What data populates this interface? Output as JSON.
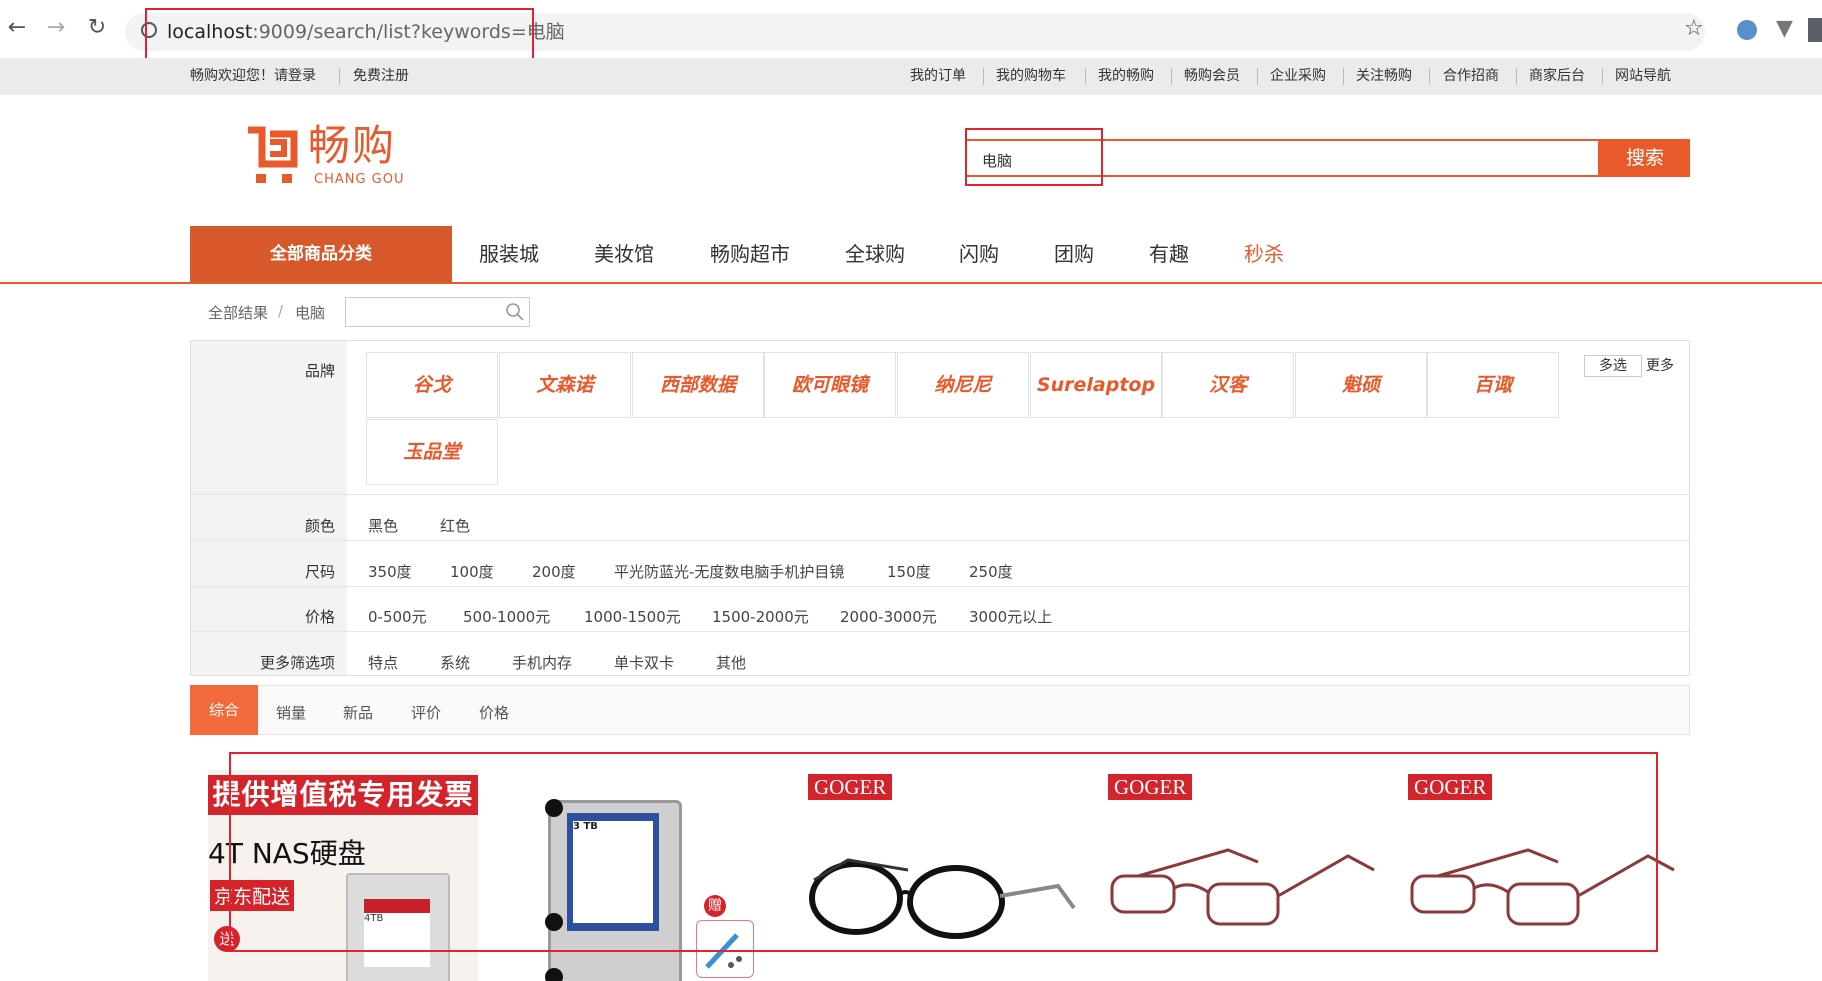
{
  "browser": {
    "url_host": "localhost",
    "url_rest": ":9009/search/list?keywords=电脑"
  },
  "topbar": {
    "welcome": "畅购欢迎您！",
    "login": "请登录",
    "register": "免费注册",
    "links": [
      "我的订单",
      "我的购物车",
      "我的畅购",
      "畅购会员",
      "企业采购",
      "关注畅购",
      "合作招商",
      "商家后台",
      "网站导航"
    ]
  },
  "logo": {
    "cn": "畅购",
    "en": "CHANG GOU"
  },
  "search": {
    "value": "电脑",
    "button": "搜索"
  },
  "nav": {
    "all_categories": "全部商品分类",
    "items": [
      "服装城",
      "美妆馆",
      "畅购超市",
      "全球购",
      "闪购",
      "团购",
      "有趣",
      "秒杀"
    ]
  },
  "breadcrumb": {
    "root": "全部结果",
    "sep": "/",
    "current": "电脑"
  },
  "filters": {
    "brand_label": "品牌",
    "brands": [
      "谷戈",
      "文森诺",
      "西部数据",
      "欧可眼镜",
      "纳尼尼",
      "Surelaptop",
      "汉客",
      "魁硕",
      "百诹",
      "玉品堂"
    ],
    "multi_select": "多选",
    "more": "更多",
    "color_label": "颜色",
    "colors": [
      "黑色",
      "红色"
    ],
    "size_label": "尺码",
    "sizes": [
      "350度",
      "100度",
      "200度",
      "平光防蓝光-无度数电脑手机护目镜",
      "150度",
      "250度"
    ],
    "price_label": "价格",
    "prices": [
      "0-500元",
      "500-1000元",
      "1000-1500元",
      "1500-2000元",
      "2000-3000元",
      "3000元以上"
    ],
    "more_label": "更多筛选项",
    "more_options": [
      "特点",
      "系统",
      "手机内存",
      "单卡双卡",
      "其他"
    ]
  },
  "sort": {
    "items": [
      "综合",
      "销量",
      "新品",
      "评价",
      "价格"
    ]
  },
  "products": {
    "p1": {
      "banner": "提供增值税专用发票",
      "title": "4T NAS硬盘",
      "tag": "京东配送",
      "gift": "送",
      "hdd_label": "4TB"
    },
    "p2": {
      "hdd_label": "3 TB",
      "gift": "赠"
    },
    "goger": "GOGER"
  },
  "colors": {
    "accent": "#e8592b",
    "annotation": "#e0232f"
  }
}
